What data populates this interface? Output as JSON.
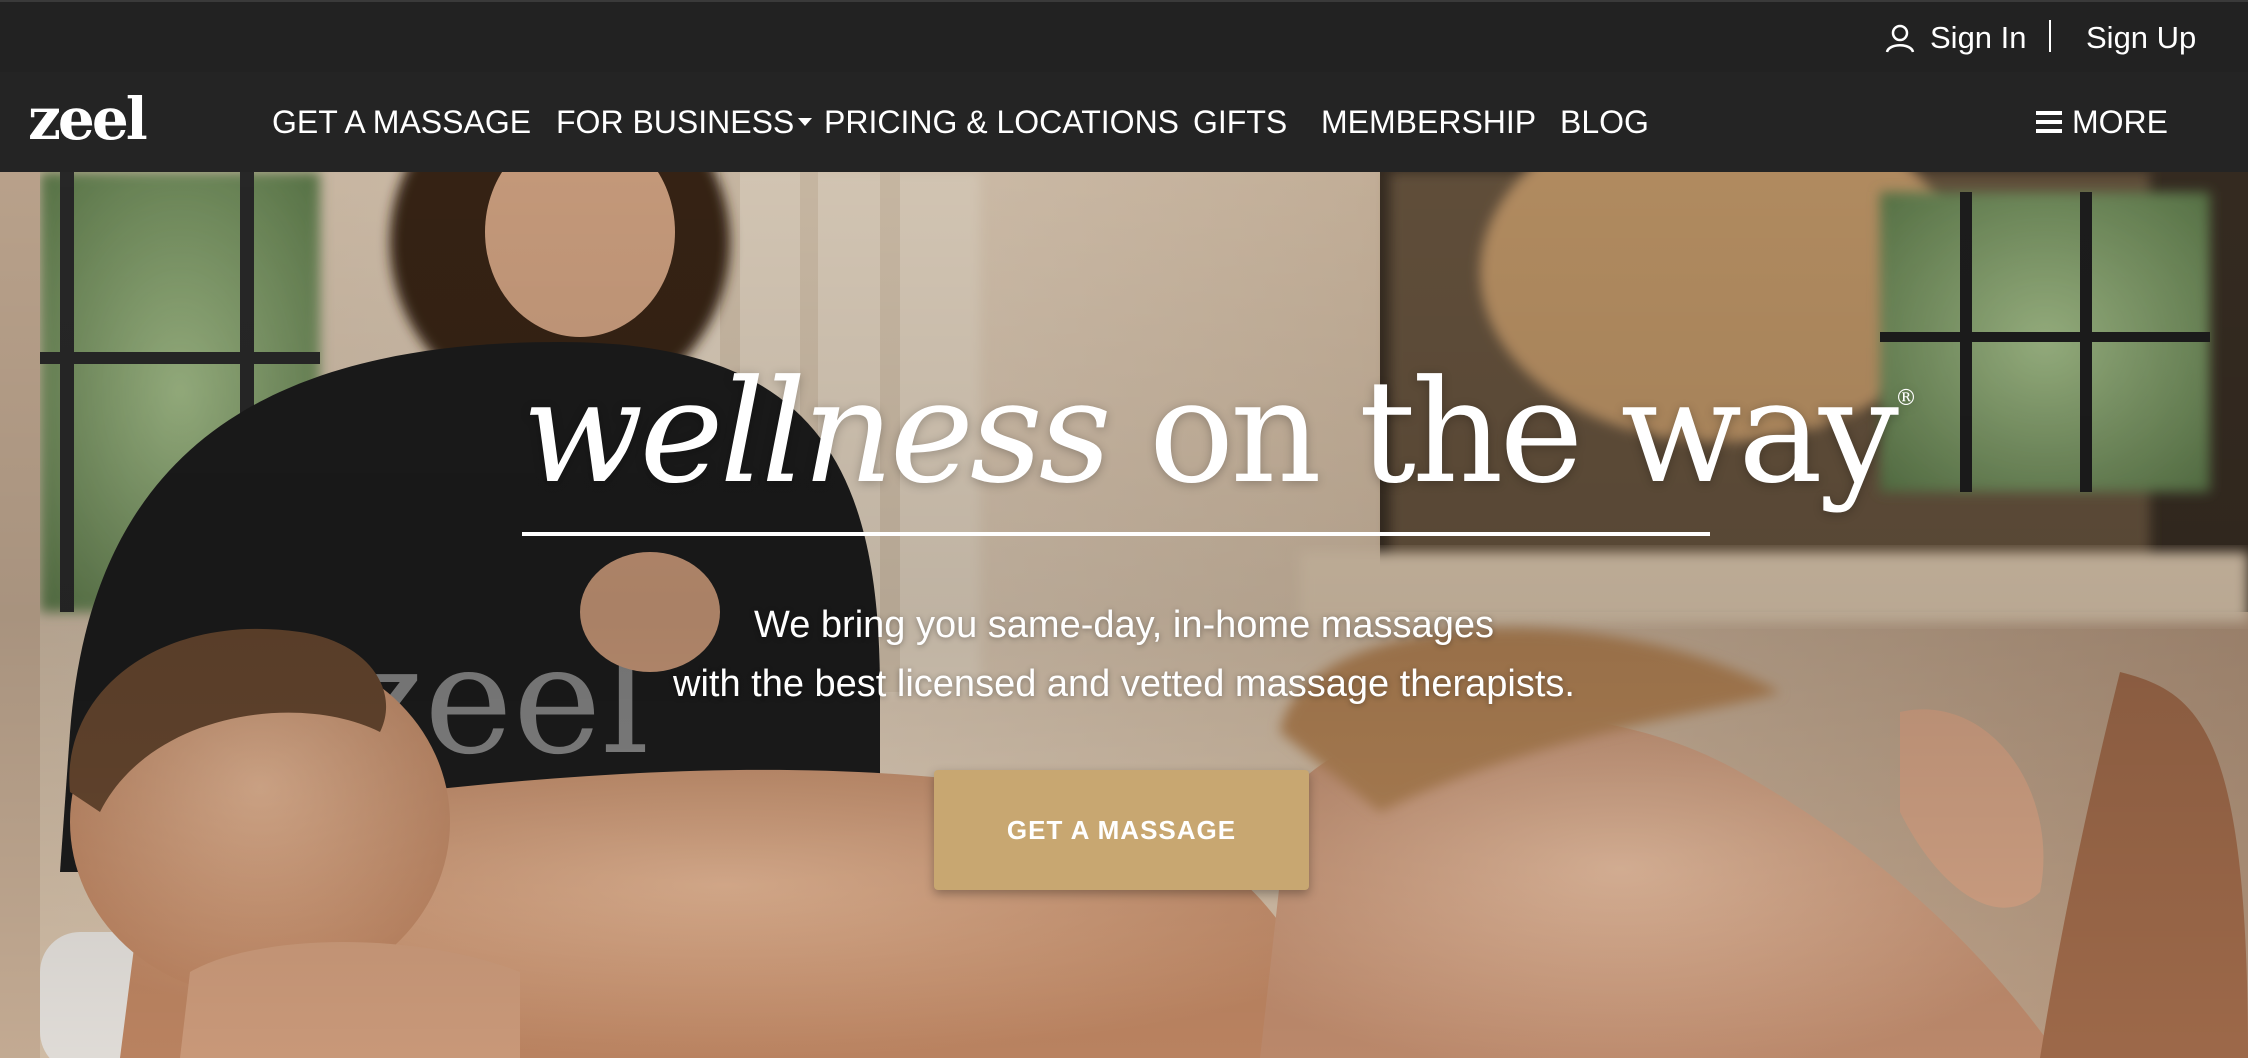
{
  "topbar": {
    "sign_in_label": "Sign In",
    "sign_up_label": "Sign Up"
  },
  "logo": {
    "text": "zeel"
  },
  "nav": {
    "items": [
      {
        "label": "GET A MASSAGE"
      },
      {
        "label": "FOR BUSINESS",
        "has_dropdown": true
      },
      {
        "label": "PRICING & LOCATIONS"
      },
      {
        "label": "GIFTS"
      },
      {
        "label": "MEMBERSHIP"
      },
      {
        "label": "BLOG"
      }
    ],
    "more_label": "MORE"
  },
  "hero": {
    "headline_italic": "wellness",
    "headline_rest": " on the way",
    "registered_mark": "®",
    "subline_1": "We bring you same-day, in-home massages",
    "subline_2": "with the best licensed and vetted massage therapists.",
    "cta_label": "GET A MASSAGE",
    "shirt_text": "zeel"
  },
  "colors": {
    "bar_bg": "#222222",
    "accent": "#c8a771",
    "text": "#ffffff"
  },
  "icons": {
    "user": "user-icon",
    "dropdown": "caret-down-icon",
    "menu": "hamburger-icon"
  }
}
